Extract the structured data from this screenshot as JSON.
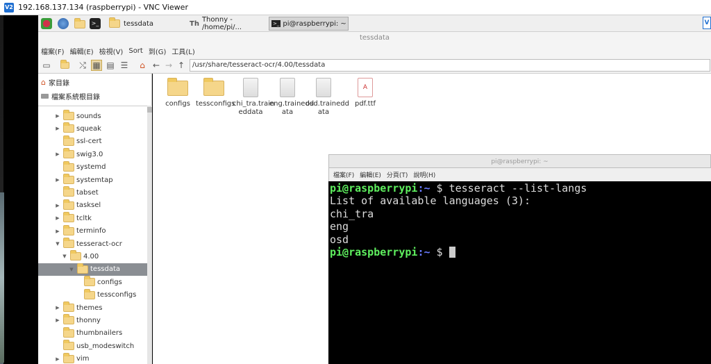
{
  "window": {
    "title": "192.168.137.134 (raspberrypi) - VNC Viewer",
    "icon": "vnc-icon",
    "icon_text": "V2"
  },
  "taskbar": {
    "items": [
      {
        "label": "tessdata",
        "icon": "folder-icon"
      },
      {
        "label": "Thonny  -  /home/pi/...",
        "icon": "thonny-icon"
      },
      {
        "label": "pi@raspberrypi: ~",
        "icon": "terminal-icon"
      }
    ],
    "terminal_icon_text": ">_",
    "corner_text": "V"
  },
  "file_manager": {
    "title": "tessdata",
    "menu": [
      "檔案(F)",
      "編輯(E)",
      "檢視(V)",
      "Sort",
      "到(G)",
      "工具(L)"
    ],
    "path": "/usr/share/tesseract-ocr/4.00/tessdata",
    "places": [
      {
        "label": "家目錄",
        "icon": "home-icon"
      },
      {
        "label": "檔案系統根目錄",
        "icon": "drive-icon"
      }
    ],
    "tree": [
      {
        "label": "sounds",
        "arrow": "▶",
        "indent": 0
      },
      {
        "label": "squeak",
        "arrow": "▶",
        "indent": 0
      },
      {
        "label": "ssl-cert",
        "arrow": "",
        "indent": 0
      },
      {
        "label": "swig3.0",
        "arrow": "▶",
        "indent": 0
      },
      {
        "label": "systemd",
        "arrow": "",
        "indent": 0
      },
      {
        "label": "systemtap",
        "arrow": "▶",
        "indent": 0
      },
      {
        "label": "tabset",
        "arrow": "",
        "indent": 0
      },
      {
        "label": "tasksel",
        "arrow": "▶",
        "indent": 0
      },
      {
        "label": "tcltk",
        "arrow": "▶",
        "indent": 0
      },
      {
        "label": "terminfo",
        "arrow": "▶",
        "indent": 0
      },
      {
        "label": "tesseract-ocr",
        "arrow": "▼",
        "indent": 0
      },
      {
        "label": "4.00",
        "arrow": "▼",
        "indent": 1
      },
      {
        "label": "tessdata",
        "arrow": "▼",
        "indent": 2,
        "selected": true
      },
      {
        "label": "configs",
        "arrow": "",
        "indent": 3
      },
      {
        "label": "tessconfigs",
        "arrow": "",
        "indent": 3
      },
      {
        "label": "themes",
        "arrow": "▶",
        "indent": 0
      },
      {
        "label": "thonny",
        "arrow": "▶",
        "indent": 0
      },
      {
        "label": "thumbnailers",
        "arrow": "",
        "indent": 0
      },
      {
        "label": "usb_modeswitch",
        "arrow": "",
        "indent": 0
      },
      {
        "label": "vim",
        "arrow": "▶",
        "indent": 0
      }
    ],
    "files": [
      {
        "line1": "configs",
        "line2": "",
        "type": "folder"
      },
      {
        "line1": "tessconfigs",
        "line2": "",
        "type": "folder"
      },
      {
        "line1": "chi_tra.train",
        "line2": "eddata",
        "type": "doc"
      },
      {
        "line1": "eng.trainedd",
        "line2": "ata",
        "type": "doc"
      },
      {
        "line1": "osd.trainedd",
        "line2": "ata",
        "type": "doc"
      },
      {
        "line1": "pdf.ttf",
        "line2": "",
        "type": "pdf"
      }
    ]
  },
  "terminal": {
    "title": "pi@raspberrypi: ~",
    "menu": [
      "檔案(F)",
      "編輯(E)",
      "分頁(T)",
      "說明(H)"
    ],
    "prompt_user": "pi@raspberrypi",
    "prompt_path": ":~",
    "prompt_symbol": " $ ",
    "command": "tesseract --list-langs",
    "output": [
      "List of available languages (3):",
      "chi_tra",
      "eng",
      "osd"
    ]
  },
  "colors": {
    "prompt_green": "#5ff05f",
    "prompt_blue": "#6a7bff",
    "selection": "#8a8e93"
  }
}
